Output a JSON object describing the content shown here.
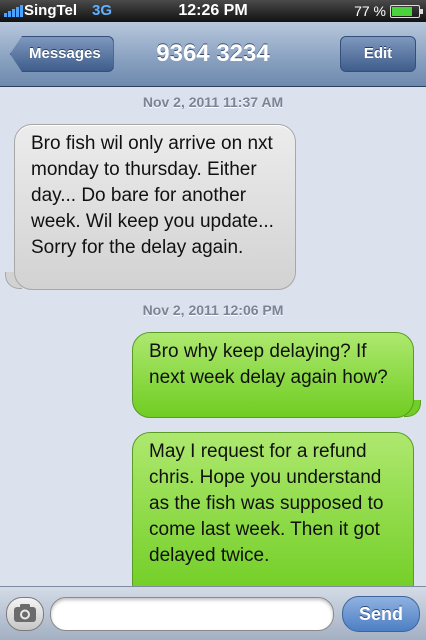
{
  "status_bar": {
    "carrier": "SingTel",
    "network": "3G",
    "time": "12:26 PM",
    "battery_percent": "77 %",
    "battery_level": 0.77
  },
  "nav_bar": {
    "back_label": "Messages",
    "title": "9364 3234",
    "edit_label": "Edit"
  },
  "conversation": {
    "timestamps": [
      "Nov 2, 2011 11:37 AM",
      "Nov 2, 2011 12:06 PM"
    ],
    "messages": [
      {
        "direction": "incoming",
        "text": "Bro fish wil only arrive on nxt monday to thursday. Either day... Do bare for another week. Wil keep you update... Sorry for the delay again."
      },
      {
        "direction": "outgoing",
        "text": "Bro why keep delaying? If next week delay again how?"
      },
      {
        "direction": "outgoing",
        "text": "May I request for a refund chris. Hope you understand as the fish was supposed to come last week. Then it got delayed twice."
      }
    ]
  },
  "input_bar": {
    "camera_icon": "camera-icon",
    "send_label": "Send",
    "field_value": ""
  },
  "colors": {
    "incoming_bubble": "#d9d9d9",
    "outgoing_bubble": "#8ad84a",
    "nav_bar": "#8fa6c4",
    "send_button": "#5d8ccf"
  }
}
